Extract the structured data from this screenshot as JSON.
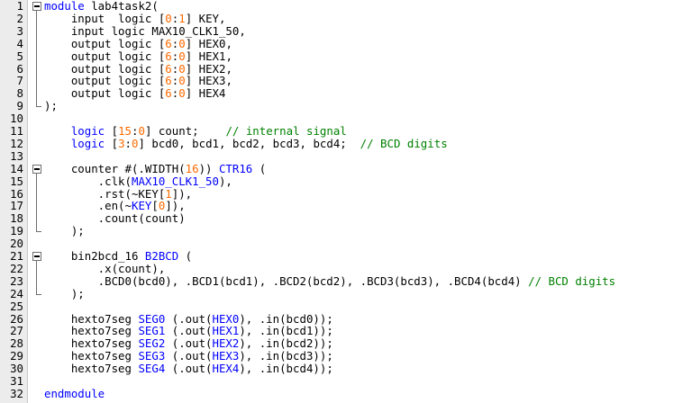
{
  "theme": {
    "keyword": "#0000ff",
    "number": "#ff6a00",
    "comment": "#008000",
    "text": "#000000"
  },
  "lines": [
    {
      "n": "1",
      "fold": "start",
      "tokens": [
        [
          "kw",
          "module"
        ],
        [
          "t",
          " lab4task2("
        ]
      ]
    },
    {
      "n": "2",
      "tokens": [
        [
          "t",
          "    input  logic ["
        ],
        [
          "num",
          "0"
        ],
        [
          "t",
          ":"
        ],
        [
          "num",
          "1"
        ],
        [
          "t",
          "] KEY,"
        ]
      ]
    },
    {
      "n": "3",
      "tokens": [
        [
          "t",
          "    input logic MAX10_CLK1_50,"
        ]
      ]
    },
    {
      "n": "4",
      "tokens": [
        [
          "t",
          "    output logic ["
        ],
        [
          "num",
          "6"
        ],
        [
          "t",
          ":"
        ],
        [
          "num",
          "0"
        ],
        [
          "t",
          "] HEX0,"
        ]
      ]
    },
    {
      "n": "5",
      "tokens": [
        [
          "t",
          "    output logic ["
        ],
        [
          "num",
          "6"
        ],
        [
          "t",
          ":"
        ],
        [
          "num",
          "0"
        ],
        [
          "t",
          "] HEX1,"
        ]
      ]
    },
    {
      "n": "6",
      "tokens": [
        [
          "t",
          "    output logic ["
        ],
        [
          "num",
          "6"
        ],
        [
          "t",
          ":"
        ],
        [
          "num",
          "0"
        ],
        [
          "t",
          "] HEX2,"
        ]
      ]
    },
    {
      "n": "7",
      "tokens": [
        [
          "t",
          "    output logic ["
        ],
        [
          "num",
          "6"
        ],
        [
          "t",
          ":"
        ],
        [
          "num",
          "0"
        ],
        [
          "t",
          "] HEX3,"
        ]
      ]
    },
    {
      "n": "8",
      "tokens": [
        [
          "t",
          "    output logic ["
        ],
        [
          "num",
          "6"
        ],
        [
          "t",
          ":"
        ],
        [
          "num",
          "0"
        ],
        [
          "t",
          "] HEX4"
        ]
      ]
    },
    {
      "n": "9",
      "fold": "end",
      "tokens": [
        [
          "t",
          ");"
        ]
      ]
    },
    {
      "n": "10",
      "tokens": []
    },
    {
      "n": "11",
      "tokens": [
        [
          "t",
          "    "
        ],
        [
          "kw",
          "logic"
        ],
        [
          "t",
          " ["
        ],
        [
          "num",
          "15"
        ],
        [
          "t",
          ":"
        ],
        [
          "num",
          "0"
        ],
        [
          "t",
          "] count;    "
        ],
        [
          "cm",
          "// internal signal"
        ]
      ]
    },
    {
      "n": "12",
      "tokens": [
        [
          "t",
          "    "
        ],
        [
          "kw",
          "logic"
        ],
        [
          "t",
          " ["
        ],
        [
          "num",
          "3"
        ],
        [
          "t",
          ":"
        ],
        [
          "num",
          "0"
        ],
        [
          "t",
          "] bcd0, bcd1, bcd2, bcd3, bcd4;  "
        ],
        [
          "cm",
          "// BCD digits"
        ]
      ]
    },
    {
      "n": "13",
      "tokens": []
    },
    {
      "n": "14",
      "fold": "start",
      "tokens": [
        [
          "t",
          "    counter #(.WIDTH("
        ],
        [
          "num",
          "16"
        ],
        [
          "t",
          ")) "
        ],
        [
          "id",
          "CTR16"
        ],
        [
          "t",
          " ("
        ]
      ]
    },
    {
      "n": "15",
      "tokens": [
        [
          "t",
          "        .clk("
        ],
        [
          "id",
          "MAX10_CLK1_50"
        ],
        [
          "t",
          "),"
        ]
      ]
    },
    {
      "n": "16",
      "tokens": [
        [
          "t",
          "        .rst(~KEY["
        ],
        [
          "num",
          "1"
        ],
        [
          "t",
          "]),"
        ]
      ]
    },
    {
      "n": "17",
      "tokens": [
        [
          "t",
          "        .en(~"
        ],
        [
          "id",
          "KEY"
        ],
        [
          "t",
          "["
        ],
        [
          "num",
          "0"
        ],
        [
          "t",
          "]),"
        ]
      ]
    },
    {
      "n": "18",
      "tokens": [
        [
          "t",
          "        .count(count)"
        ]
      ]
    },
    {
      "n": "19",
      "fold": "end",
      "tokens": [
        [
          "t",
          "    );"
        ]
      ]
    },
    {
      "n": "20",
      "tokens": []
    },
    {
      "n": "21",
      "fold": "start",
      "tokens": [
        [
          "t",
          "    bin2bcd_16 "
        ],
        [
          "id",
          "B2BCD"
        ],
        [
          "t",
          " ("
        ]
      ]
    },
    {
      "n": "22",
      "tokens": [
        [
          "t",
          "        .x(count),"
        ]
      ]
    },
    {
      "n": "23",
      "tokens": [
        [
          "t",
          "        .BCD0(bcd0), .BCD1(bcd1), .BCD2(bcd2), .BCD3(bcd3), .BCD4(bcd4) "
        ],
        [
          "cm",
          "// BCD digits"
        ]
      ]
    },
    {
      "n": "24",
      "fold": "end",
      "tokens": [
        [
          "t",
          "    );"
        ]
      ]
    },
    {
      "n": "25",
      "tokens": []
    },
    {
      "n": "26",
      "tokens": [
        [
          "t",
          "    hexto7seg "
        ],
        [
          "id",
          "SEG0"
        ],
        [
          "t",
          " (.out("
        ],
        [
          "id",
          "HEX0"
        ],
        [
          "t",
          "), .in(bcd0));"
        ]
      ]
    },
    {
      "n": "27",
      "tokens": [
        [
          "t",
          "    hexto7seg "
        ],
        [
          "id",
          "SEG1"
        ],
        [
          "t",
          " (.out("
        ],
        [
          "id",
          "HEX1"
        ],
        [
          "t",
          "), .in(bcd1));"
        ]
      ]
    },
    {
      "n": "28",
      "tokens": [
        [
          "t",
          "    hexto7seg "
        ],
        [
          "id",
          "SEG2"
        ],
        [
          "t",
          " (.out("
        ],
        [
          "id",
          "HEX2"
        ],
        [
          "t",
          "), .in(bcd2));"
        ]
      ]
    },
    {
      "n": "29",
      "tokens": [
        [
          "t",
          "    hexto7seg "
        ],
        [
          "id",
          "SEG3"
        ],
        [
          "t",
          " (.out("
        ],
        [
          "id",
          "HEX3"
        ],
        [
          "t",
          "), .in(bcd3));"
        ]
      ]
    },
    {
      "n": "30",
      "tokens": [
        [
          "t",
          "    hexto7seg "
        ],
        [
          "id",
          "SEG4"
        ],
        [
          "t",
          " (.out("
        ],
        [
          "id",
          "HEX4"
        ],
        [
          "t",
          "), .in(bcd4));"
        ]
      ]
    },
    {
      "n": "31",
      "tokens": []
    },
    {
      "n": "32",
      "tokens": [
        [
          "kw",
          "endmodule"
        ]
      ]
    }
  ]
}
